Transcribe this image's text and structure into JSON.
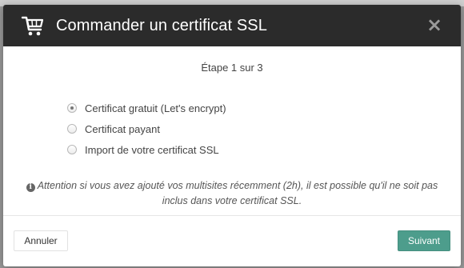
{
  "modal": {
    "title": "Commander un certificat SSL",
    "step": "Étape 1 sur 3",
    "options": [
      {
        "label": "Certificat gratuit (Let's encrypt)",
        "selected": true
      },
      {
        "label": "Certificat payant",
        "selected": false
      },
      {
        "label": "Import de votre certificat SSL",
        "selected": false
      }
    ],
    "notice": "Attention si vous avez ajouté vos multisites récemment (2h), il est possible qu'il ne soit pas inclus dans votre certificat SSL.",
    "buttons": {
      "cancel": "Annuler",
      "next": "Suivant"
    },
    "icons": {
      "header": "shopping-cart-icon",
      "close": "close-icon",
      "notice": "info-icon"
    },
    "colors": {
      "header_bg": "#2b2b2b",
      "primary": "#4d9d8c"
    }
  }
}
